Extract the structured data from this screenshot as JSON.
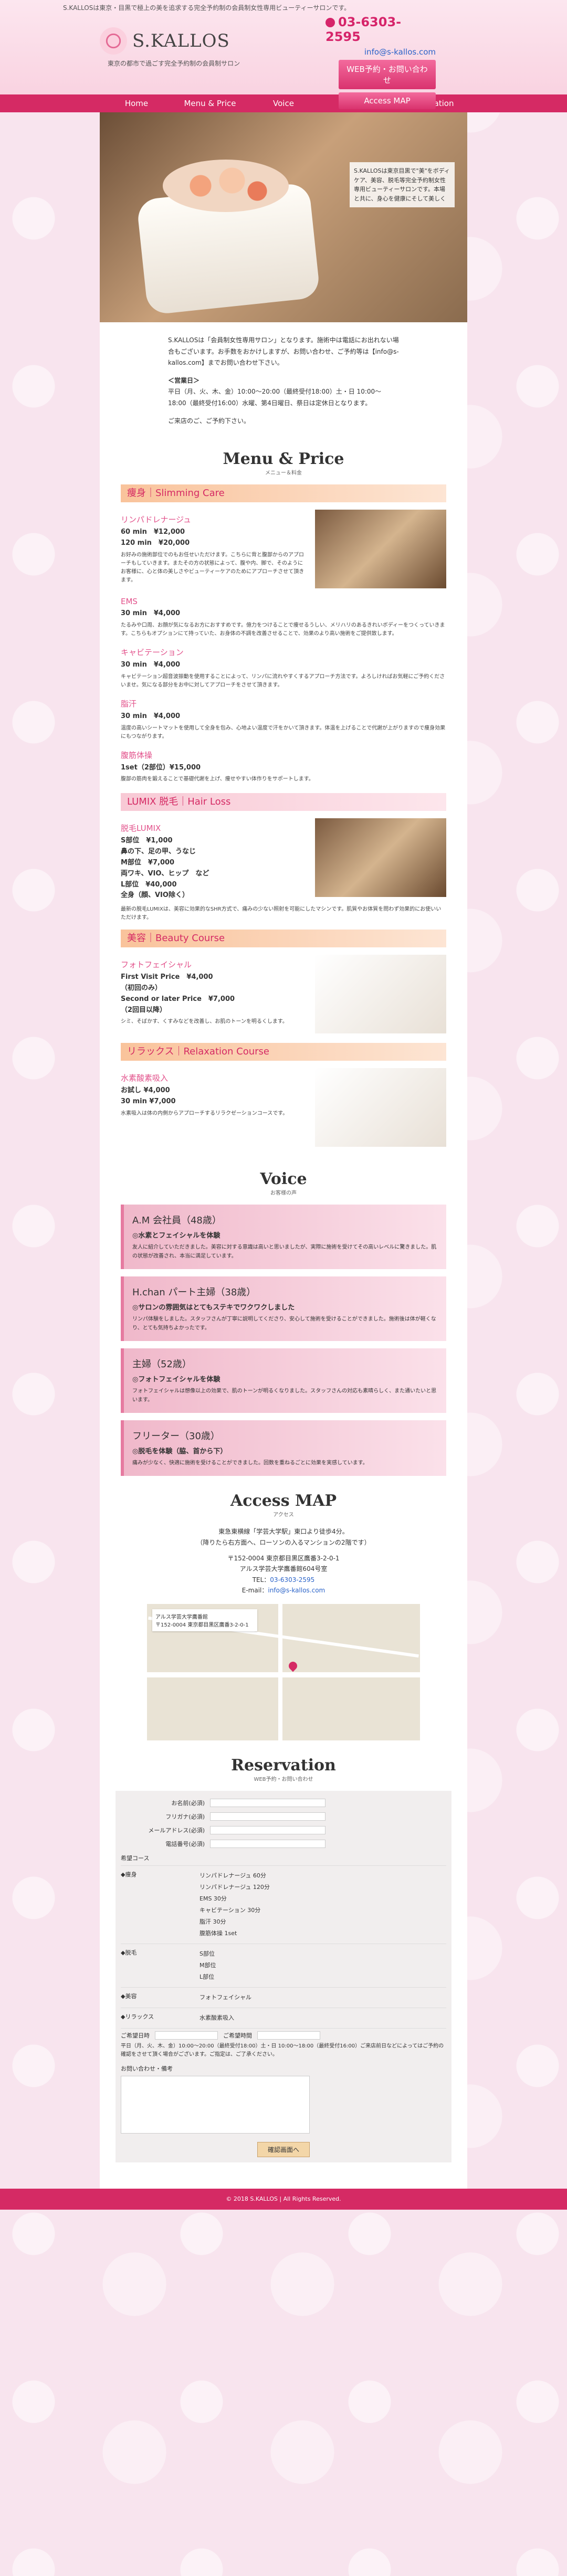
{
  "header": {
    "tagline": "S.KALLOSは東京・目黒で極上の美を追求する完全予約制の会員制女性専用ビューティーサロンです。",
    "logo": "S.KALLOS",
    "sub": "東京の都市で過ごす完全予約制の会員制サロン",
    "phone": "03-6303-2595",
    "email": "info@s-kallos.com",
    "btn_web": "WEB予約・お問い合わせ",
    "btn_map": "Access MAP"
  },
  "nav": [
    "Home",
    "Menu & Price",
    "Voice",
    "Access",
    "Reservation"
  ],
  "hero_caption": "S.KALLOSは東京目黒で\"美\"をボディケア、美容、脱毛等完全予約制女性専用ビューティーサロンです。本場と共に、身心を健康にそして美しく",
  "intro": {
    "p1": "S.KALLOSは「会員制女性専用サロン」となります。施術中は電話にお出れない場合もございます。お手数をおかけしますが、お問い合わせ、ご予約等は【info@s-kallos.com】までお問い合わせ下さい。",
    "hours_title": "＜営業日＞",
    "hours": "平日（月、火、木、金）10:00〜20:00（最終受付18:00）土・日 10:00〜18:00（最終受付16:00）水曜、第4日曜日、祭日は定休日となります。",
    "closing": "ご来店のご、ご予約下さい。"
  },
  "menu": {
    "title": "Menu & Price",
    "sub": "メニュー＆料金",
    "categories": [
      {
        "label": "痩身｜Slimming Care",
        "items": [
          {
            "name": "リンパドレナージュ",
            "price": "60 min　¥12,000\n120 min　¥20,000",
            "desc": "お好みの施術部位でのもお任せいただけます。こちらに背と腹部からのアプローチもしていきます。またその方の状態によって、腹や内、脚で、そのようにお客様に、心と体の美しさやビューティーケアのためにアプローチさせて頂きます。"
          },
          {
            "name": "EMS",
            "price": "30 min　¥4,000",
            "desc": "たるみや口周、お顔が気になるお方におすすめです。億力をつけることで痩せるうしい、メリハリのあるきれいボディーをつくっていきます。こちらもオプションにて持っていた、お身体の不調を改善させることで、効果のより高い施術をご提供致します。"
          },
          {
            "name": "キャビテーション",
            "price": "30 min　¥4,000",
            "desc": "キャビテーション超音波振動を使用することによって、リンパに流れやすくするアプローチ方法です。よろしければお気軽にご予約くださいませ。気になる部分をお中に対してアプローチをさせて頂きます。"
          },
          {
            "name": "脂汗",
            "price": "30 min　¥4,000",
            "desc": "温度の高いシートマットを使用して全身を包み、心地よい温度で汗をかいて頂きます。体温を上げることで代謝が上がりますので痩身効果にもつながります。"
          },
          {
            "name": "腹筋体操",
            "price": "1set（2部位）¥15,000",
            "desc": "腹部の筋肉を鍛えることで基礎代謝を上げ、痩せやすい体作りをサポートします。"
          }
        ]
      },
      {
        "label": "LUMIX 脱毛｜Hair Loss",
        "items": [
          {
            "name": "脱毛LUMIX",
            "price": "S部位　¥1,000\n鼻の下、足の甲、うなじ\nM部位　¥7,000\n両ワキ、VIO、ヒップ　など\nL部位　¥40,000\n全身（顔、VIO除く）",
            "desc": "最新の脱毛LUMIXは、美容に効果的なSHR方式で、痛みの少ない照射を可能にしたマシンです。肌質やお体質を問わず効果的にお使いいただけます。"
          }
        ]
      },
      {
        "label": "美容｜Beauty Course",
        "items": [
          {
            "name": "フォトフェイシャル",
            "price": "First Visit Price　¥4,000\n（初回のみ）\nSecond or later Price　¥7,000\n（2回目以降）",
            "desc": "シミ、そばかす、くすみなどを改善し、お肌のトーンを明るくします。"
          }
        ]
      },
      {
        "label": "リラックス｜Relaxation Course",
        "items": [
          {
            "name": "水素酸素吸入",
            "price": "お試し ¥4,000\n30 min ¥7,000",
            "desc": "水素吸入は体の内側からアプローチするリラクゼーションコースです。"
          }
        ]
      }
    ]
  },
  "voice": {
    "title": "Voice",
    "sub": "お客様の声",
    "items": [
      {
        "name": "A.M 会社員（48歳）",
        "title": "◎水素とフェイシャルを体験",
        "text": "友人に紹介していただきました。美容に対する意識は高いと思いましたが、実際に施術を受けてその高いレベルに驚きました。肌の状態が改善され、本当に満足しています。"
      },
      {
        "name": "H.chan パート主婦（38歳）",
        "title": "◎サロンの雰囲気はとてもステキでワクワクしました",
        "text": "リンパ体験をしました。スタッフさんが丁寧に説明してくださり、安心して施術を受けることができました。施術後は体が軽くなり、とても気持ちよかったです。"
      },
      {
        "name": "主婦（52歳）",
        "title": "◎フォトフェイシャルを体験",
        "text": "フォトフェイシャルは想像以上の効果で、肌のトーンが明るくなりました。スタッフさんの対応も素晴らしく、また通いたいと思います。"
      },
      {
        "name": "フリーター（30歳）",
        "title": "◎脱毛を体験（脇、首から下）",
        "text": "痛みが少なく、快適に施術を受けることができました。回数を重ねるごとに効果を実感しています。"
      }
    ]
  },
  "access": {
    "title": "Access MAP",
    "sub": "アクセス",
    "line1": "東急東横線「学芸大学駅」東口より徒歩4分。",
    "line2": "（降りたら右方面へ、ローソンの入るマンションの2階です）",
    "address": "〒152-0004 東京都目黒区鷹番3-2-0-1",
    "building": "アルス学芸大学鷹番館604号室",
    "tel_label": "TEL：",
    "tel": "03-6303-2595",
    "email_label": "E-mail：",
    "email": "info@s-kallos.com",
    "map_label": "アルス学芸大学鷹番館\n〒152-0004 東京都目黒区鷹番3-2-0-1"
  },
  "reservation": {
    "title": "Reservation",
    "sub": "WEB予約・お問い合わせ",
    "fields": [
      {
        "label": "お名前(必須)"
      },
      {
        "label": "フリガナ(必須)"
      },
      {
        "label": "メールアドレス(必須)"
      },
      {
        "label": "電話番号(必須)"
      }
    ],
    "course_label": "希望コース",
    "groups": [
      {
        "name": "◆痩身",
        "options": [
          "リンパドレナージュ 60分",
          "リンパドレナージュ 120分",
          "EMS 30分",
          "キャビテーション 30分",
          "脂汗 30分",
          "腹筋体操 1set"
        ]
      },
      {
        "name": "◆脱毛",
        "options": [
          "S部位",
          "M部位",
          "L部位"
        ]
      },
      {
        "name": "◆美容",
        "options": [
          "フォトフェイシャル"
        ]
      },
      {
        "name": "◆リラックス",
        "options": [
          "水素酸素吸入"
        ]
      }
    ],
    "date_label": "ご希望日時",
    "date2_label": "ご希望時間",
    "note": "平日（月、火、木、金）10:00〜20:00（最終受付18:00）土・日 10:00〜18:00（最終受付16:00）ご来店前日などによってはご予約の確認をさせて頂く場合がございます。ご指定は、ご了承ください。",
    "msg_label": "お問い合わせ・備考",
    "submit": "確認画面へ"
  },
  "footer": "© 2018 S.KALLOS | All Rights Reserved."
}
